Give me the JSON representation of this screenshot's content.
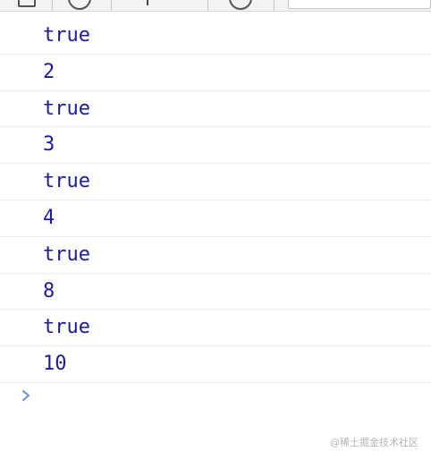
{
  "console": {
    "entries": [
      {
        "value": "true"
      },
      {
        "value": "2"
      },
      {
        "value": "true"
      },
      {
        "value": "3"
      },
      {
        "value": "true"
      },
      {
        "value": "4"
      },
      {
        "value": "true"
      },
      {
        "value": "8"
      },
      {
        "value": "true"
      },
      {
        "value": "10"
      }
    ],
    "value_color": "#1a1aa6",
    "prompt_icon": "chevron-right-icon",
    "prompt_color": "#6a8fd8"
  },
  "watermark": {
    "text": "@稀土掘金技术社区"
  }
}
